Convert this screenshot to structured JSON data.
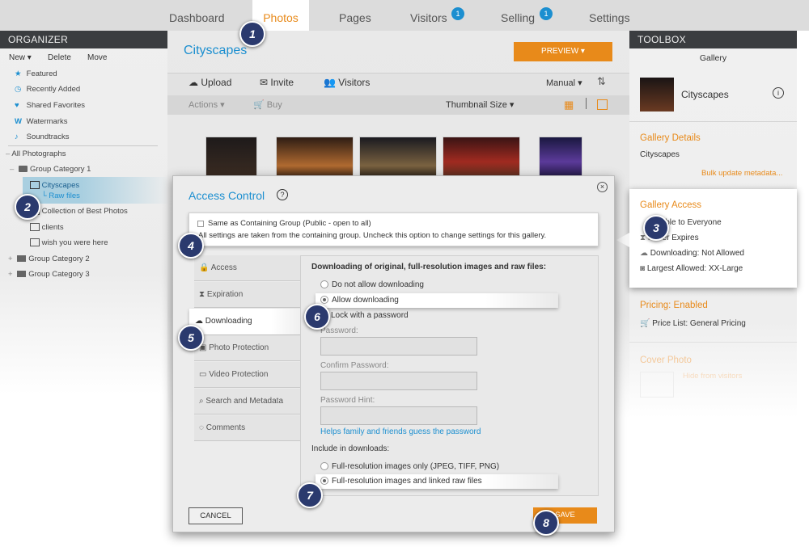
{
  "nav": {
    "items": [
      {
        "label": "Dashboard"
      },
      {
        "label": "Photos"
      },
      {
        "label": "Pages"
      },
      {
        "label": "Visitors",
        "badge": "1"
      },
      {
        "label": "Selling",
        "badge": "1"
      },
      {
        "label": "Settings"
      }
    ],
    "active_color": "#e88a1a"
  },
  "organizer": {
    "title": "ORGANIZER",
    "actions": [
      "New",
      "Delete",
      "Move"
    ],
    "items": [
      {
        "label": "Featured",
        "icon": "star-icon"
      },
      {
        "label": "Recently Added",
        "icon": "clock-icon"
      },
      {
        "label": "Shared Favorites",
        "icon": "heart-icon"
      },
      {
        "label": "Watermarks",
        "icon": "w-icon"
      },
      {
        "label": "Soundtracks",
        "icon": "music-icon"
      },
      {
        "label": "All Photographs"
      },
      {
        "label": "Group Category 1"
      },
      {
        "label": "Cityscapes"
      },
      {
        "label": "Raw files"
      },
      {
        "label": "Collection of Best Photos"
      },
      {
        "label": "clients"
      },
      {
        "label": "wish you were here"
      },
      {
        "label": "Group Category 2"
      },
      {
        "label": "Group Category 3"
      }
    ]
  },
  "gallery": {
    "title": "Cityscapes",
    "preview": "PREVIEW",
    "toolbar": {
      "upload": "Upload",
      "invite": "Invite",
      "visitors": "Visitors",
      "sort": "Manual"
    },
    "subbar": {
      "actions": "Actions",
      "buy": "Buy",
      "thumb_size": "Thumbnail Size"
    }
  },
  "toolbox": {
    "title": "TOOLBOX",
    "gallery_label": "Gallery",
    "gallery_name": "Cityscapes",
    "details_heading": "Gallery Details",
    "details_value": "Cityscapes",
    "bulk_link": "Bulk update metadata...",
    "access_heading": "Gallery Access",
    "access_items": [
      "ible to Everyone",
      "Never Expires",
      "Downloading: Not Allowed",
      "Largest Allowed: XX-Large"
    ],
    "pricing_heading": "Pricing: Enabled",
    "price_list": "Price List: General Pricing",
    "cover_heading": "Cover Photo",
    "cover_link": "Hide from visitors"
  },
  "dialog": {
    "title": "Access Control",
    "same_as_group": "Same as Containing Group (Public - open to all)",
    "same_as_group_note": "All settings are taken from the containing group. Uncheck this option to change settings for this gallery.",
    "tabs": [
      "Access",
      "Expiration",
      "Downloading",
      "Photo Protection",
      "Video Protection",
      "Search and Metadata",
      "Comments"
    ],
    "download_heading": "Downloading of original, full-resolution images and raw files:",
    "opt_no": "Do not allow downloading",
    "opt_allow": "Allow downloading",
    "lock": "Lock with a password",
    "password": "Password:",
    "confirm": "Confirm Password:",
    "hint": "Password Hint:",
    "hint_help": "Helps family and friends guess the password",
    "include": "Include in downloads:",
    "inc_images": "Full-resolution images only (JPEG, TIFF, PNG)",
    "inc_raw": "Full-resolution images and linked raw files",
    "cancel": "CANCEL",
    "save": "SAVE"
  },
  "callouts": [
    "1",
    "2",
    "3",
    "4",
    "5",
    "6",
    "7",
    "8"
  ],
  "colors": {
    "accent": "#e88a1a",
    "link": "#1c8fd0",
    "callout": "#2b3a6e"
  }
}
